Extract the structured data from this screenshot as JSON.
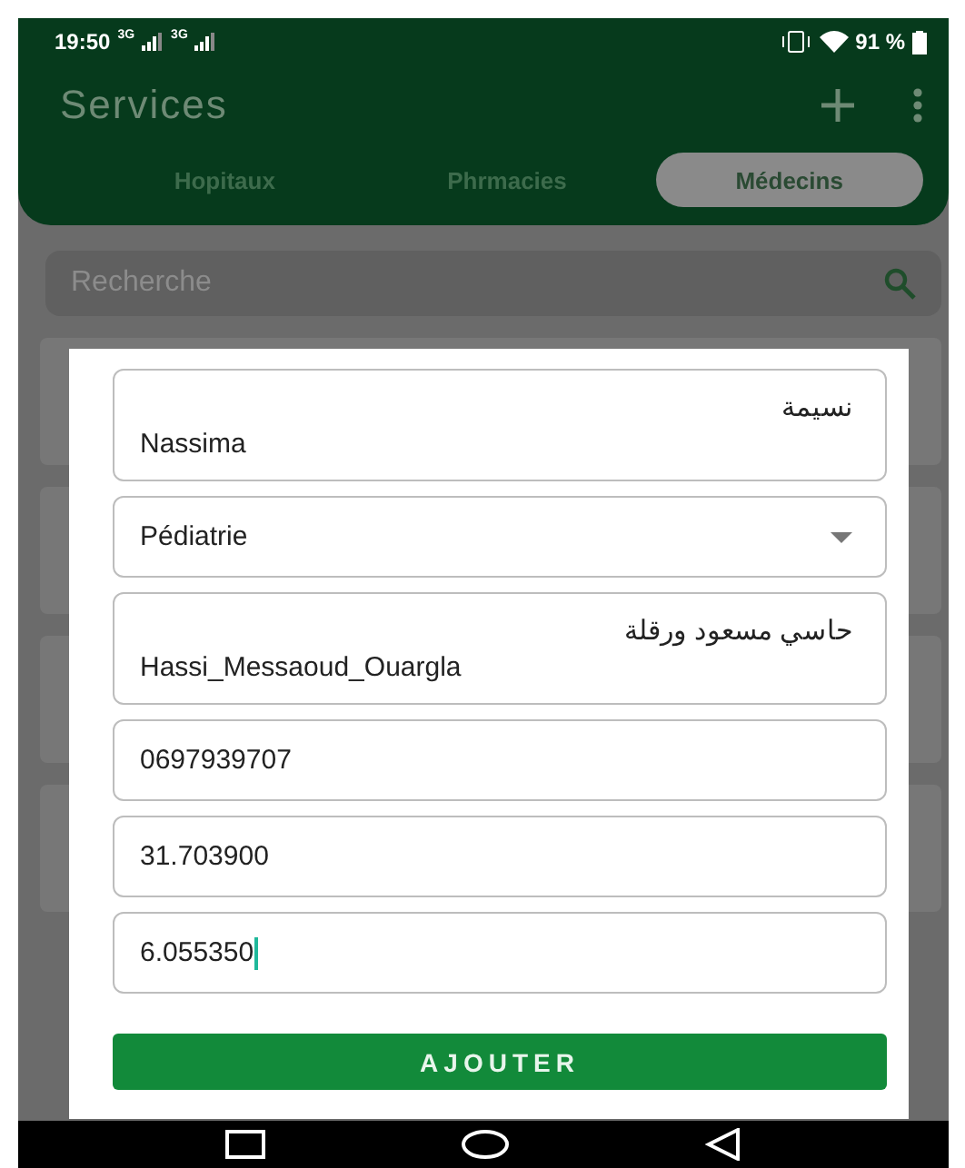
{
  "status_bar": {
    "time": "19:50",
    "network_1": "3G",
    "network_2": "3G",
    "battery": "91 %"
  },
  "app_bar": {
    "title": "Services"
  },
  "tabs": [
    {
      "label": "Hopitaux",
      "selected": false
    },
    {
      "label": "Phrmacies",
      "selected": false
    },
    {
      "label": "Médecins",
      "selected": true
    }
  ],
  "search": {
    "placeholder": "Recherche"
  },
  "dialog": {
    "fields": [
      {
        "kind": "text",
        "focused": false,
        "lines": [
          {
            "text": "نسيمة",
            "kind": "rtl"
          },
          {
            "text": "Nassima",
            "kind": "ltr"
          }
        ]
      },
      {
        "kind": "dropdown",
        "focused": false,
        "lines": [
          {
            "text": "Pédiatrie",
            "kind": "ltr"
          }
        ]
      },
      {
        "kind": "text",
        "focused": false,
        "lines": [
          {
            "text": "حاسي مسعود ورقلة",
            "kind": "rtl"
          },
          {
            "text": "Hassi_Messaoud_Ouargla",
            "kind": "ltr"
          }
        ]
      },
      {
        "kind": "text",
        "focused": false,
        "lines": [
          {
            "text": "0697939707",
            "kind": "ltr"
          }
        ]
      },
      {
        "kind": "text",
        "focused": false,
        "lines": [
          {
            "text": "31.703900",
            "kind": "ltr"
          }
        ]
      },
      {
        "kind": "text",
        "focused": true,
        "lines": [
          {
            "text": "6.055350",
            "kind": "ltr"
          }
        ]
      }
    ],
    "button": "AJOUTER"
  }
}
